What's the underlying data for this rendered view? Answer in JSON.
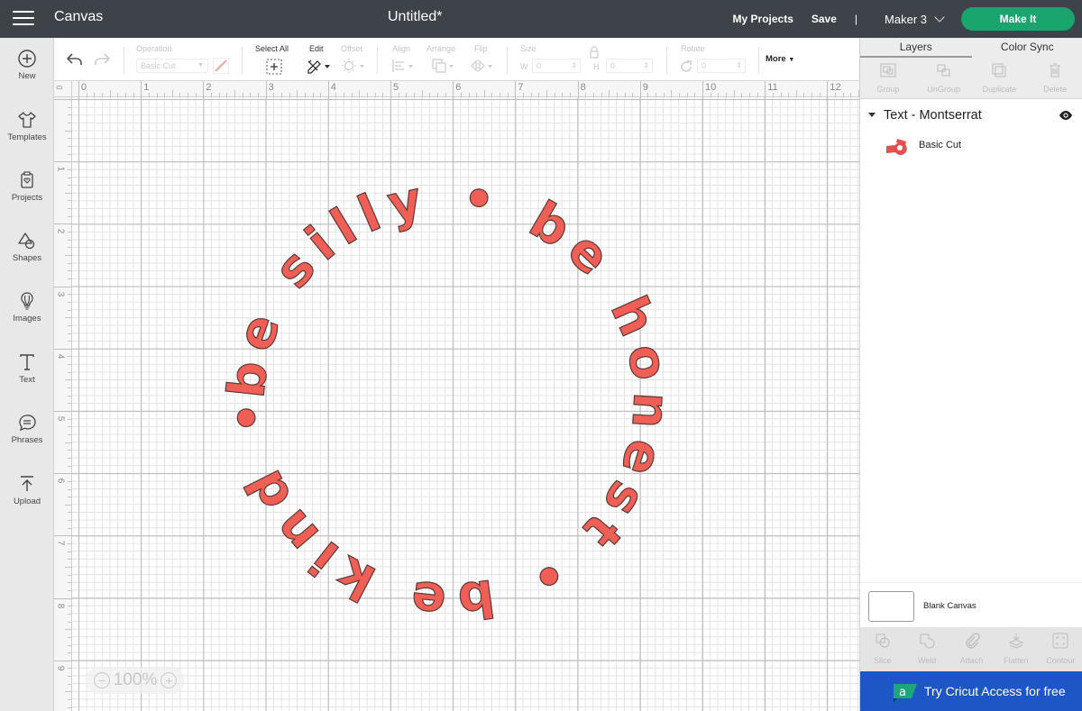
{
  "topbar": {
    "app_title": "Canvas",
    "doc_title": "Untitled*",
    "my_projects": "My Projects",
    "save": "Save",
    "separator": "|",
    "machine": "Maker 3",
    "make_it": "Make It"
  },
  "sidebar": {
    "items": [
      {
        "label": "New",
        "icon": "plus-circle-icon"
      },
      {
        "label": "Templates",
        "icon": "tshirt-icon"
      },
      {
        "label": "Projects",
        "icon": "projects-icon"
      },
      {
        "label": "Shapes",
        "icon": "shapes-icon"
      },
      {
        "label": "Images",
        "icon": "lightbulb-icon"
      },
      {
        "label": "Text",
        "icon": "text-icon"
      },
      {
        "label": "Phrases",
        "icon": "speech-bubble-icon"
      },
      {
        "label": "Upload",
        "icon": "upload-icon"
      }
    ]
  },
  "toolbar": {
    "operation_label": "Operation",
    "operation_value": "Basic Cut",
    "select_all": "Select All",
    "edit": "Edit",
    "offset": "Offset",
    "align": "Align",
    "arrange": "Arrange",
    "flip": "Flip",
    "size": "Size",
    "w_label": "W",
    "w_value": "0",
    "h_label": "H",
    "h_value": "0",
    "rotate": "Rotate",
    "rotate_value": "0",
    "more": "More"
  },
  "canvas": {
    "ruler_top": [
      "0",
      "1",
      "2",
      "3",
      "4",
      "5",
      "6",
      "7",
      "8",
      "9",
      "10",
      "11",
      "12"
    ],
    "ruler_left": [
      "0",
      "1",
      "2",
      "3",
      "4",
      "5",
      "6",
      "7",
      "8",
      "9"
    ],
    "circle_text": "be silly • be honest • be kind •",
    "text_color": "#ef5f55",
    "text_outline": "#5a3a38",
    "zoom_level": "100%"
  },
  "right_panel": {
    "tabs": [
      {
        "label": "Layers",
        "active": true
      },
      {
        "label": "Color Sync",
        "active": false
      }
    ],
    "actions": [
      "Group",
      "UnGroup",
      "Duplicate",
      "Delete"
    ],
    "layer_group": "Text - Montserrat",
    "layer_item": "Basic Cut",
    "blank_canvas": "Blank Canvas",
    "bottom_actions": [
      "Slice",
      "Weld",
      "Attach",
      "Flatten",
      "Contour"
    ],
    "access_banner": "Try Cricut Access for free"
  },
  "colors": {
    "topbar_bg": "#3e4249",
    "make_it": "#1aa56f",
    "access_banner": "#1f56c6"
  }
}
